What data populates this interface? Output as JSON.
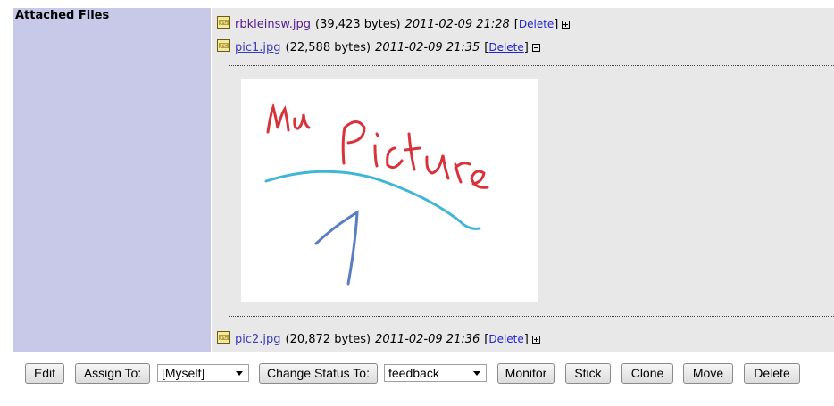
{
  "section_label": "Attached Files",
  "files": [
    {
      "name": "rbkleinsw.jpg",
      "size": "(39,423 bytes)",
      "date": "2011-02-09 21:28",
      "delete_label": "Delete",
      "expanded": false
    },
    {
      "name": "pic1.jpg",
      "size": "(22,588 bytes)",
      "date": "2011-02-09 21:35",
      "delete_label": "Delete",
      "expanded": true
    },
    {
      "name": "pic2.jpg",
      "size": "(20,872 bytes)",
      "date": "2011-02-09 21:36",
      "delete_label": "Delete",
      "expanded": false
    }
  ],
  "bracket_open": "[",
  "bracket_close": "]",
  "file_icon_name": "jpg-file-icon",
  "preview": {
    "handwriting": "Mu Picture",
    "colors": {
      "red": "#d8323a",
      "cyan": "#3fb6d6",
      "blue": "#5a7fc0"
    }
  },
  "actions": {
    "edit": "Edit",
    "assign_to": "Assign To:",
    "assign_value": "[Myself]",
    "change_status": "Change Status To:",
    "status_value": "feedback",
    "monitor": "Monitor",
    "stick": "Stick",
    "clone": "Clone",
    "move": "Move",
    "delete": "Delete"
  }
}
